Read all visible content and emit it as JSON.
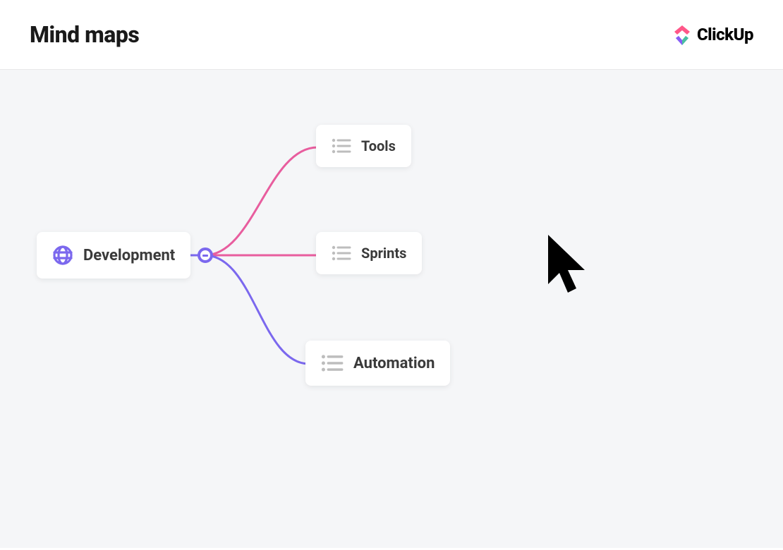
{
  "header": {
    "title": "Mind maps",
    "brand_name": "ClickUp"
  },
  "mindmap": {
    "root": {
      "label": "Development",
      "icon": "globe-icon"
    },
    "children": [
      {
        "label": "Tools",
        "icon": "list-icon"
      },
      {
        "label": "Sprints",
        "icon": "list-icon"
      },
      {
        "label": "Automation",
        "icon": "list-icon"
      }
    ],
    "colors": {
      "edge_top": "#e85d9e",
      "edge_mid": "#e85d9e",
      "edge_bottom": "#7b68ee",
      "join_dot": "#7b68ee"
    }
  }
}
